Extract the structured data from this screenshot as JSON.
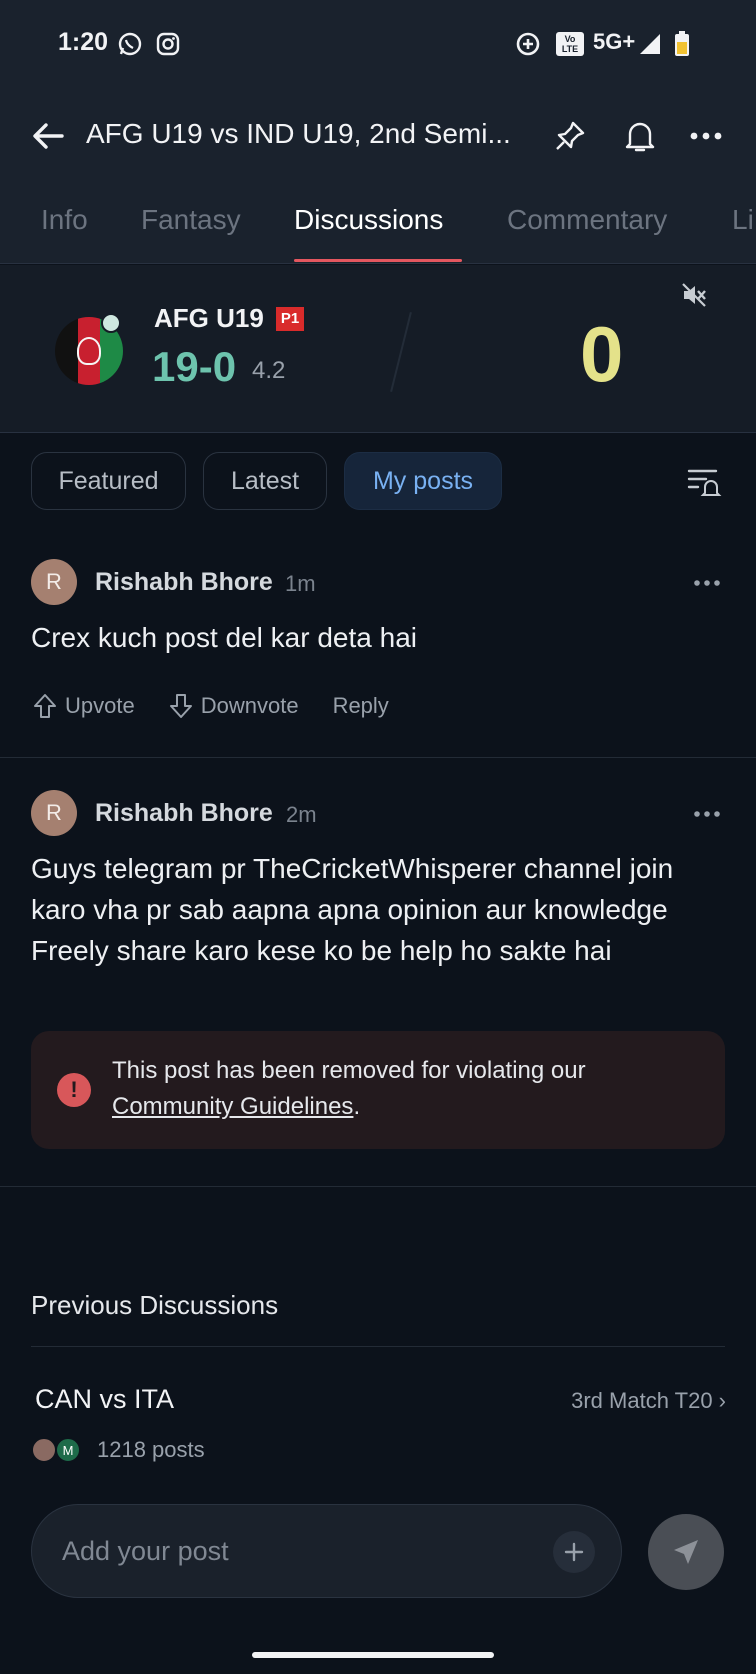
{
  "status_bar": {
    "time": "1:20",
    "network": "5G+",
    "volte": "Vo LTE"
  },
  "header": {
    "title": "AFG U19 vs IND U19, 2nd Semi..."
  },
  "tabs": [
    {
      "label": "Info",
      "active": false
    },
    {
      "label": "Fantasy",
      "active": false
    },
    {
      "label": "Discussions",
      "active": true
    },
    {
      "label": "Commentary",
      "active": false
    },
    {
      "label": "Li",
      "active": false
    }
  ],
  "score_card": {
    "team": "AFG U19",
    "badge": "P1",
    "score": "19-0",
    "overs": "4.2",
    "ball_value": "0"
  },
  "filters": {
    "chips": [
      "Featured",
      "Latest",
      "My posts"
    ],
    "active": "My posts"
  },
  "posts": [
    {
      "avatar_letter": "R",
      "author": "Rishabh Bhore",
      "time_ago": "1m",
      "body": "Crex kuch post del kar deta hai",
      "actions": {
        "upvote": "Upvote",
        "downvote": "Downvote",
        "reply": "Reply"
      }
    },
    {
      "avatar_letter": "R",
      "author": "Rishabh Bhore",
      "time_ago": "2m",
      "body": "Guys telegram pr TheCricketWhisperer channel join karo vha pr sab aapna apna opinion aur knowledge Freely share karo kese ko be help ho sakte hai",
      "removed_notice": {
        "text": "This post has been removed for violating our",
        "link": "Community Guidelines",
        "suffix": "."
      }
    }
  ],
  "previous_discussions": {
    "title": "Previous Discussions",
    "items": [
      {
        "match": "CAN vs ITA",
        "meta": "3rd Match T20 ›",
        "posts": "1218 posts",
        "avatar_letter": "M"
      }
    ]
  },
  "composer": {
    "placeholder": "Add your post"
  },
  "colors": {
    "accent_tab": "#e4575f",
    "score_green": "#6dc3ad",
    "ball_yellow": "#e4e28a",
    "chip_active": "#79b1f2",
    "warning": "#d8575a"
  },
  "icons": [
    "back-arrow-icon",
    "pin-icon",
    "bell-icon",
    "more-icon",
    "mute-icon",
    "filter-alert-icon",
    "upvote-icon",
    "downvote-icon",
    "warning-icon",
    "plus-icon",
    "send-icon"
  ]
}
